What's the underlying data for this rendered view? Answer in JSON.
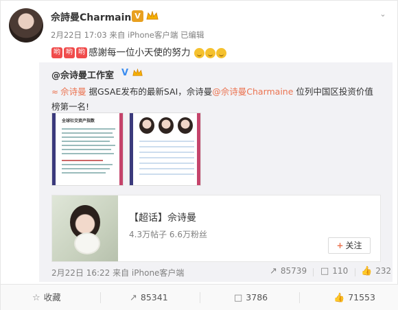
{
  "post": {
    "author": "佘詩曼Charmaine",
    "verified_badge": "V",
    "meta": "2月22日 17:03 来自 iPhone客户端   已编辑",
    "emoji_tags": [
      "哟",
      "哟",
      "哟"
    ],
    "text": "感謝每一位小天使的努力"
  },
  "repost": {
    "author": "@佘诗曼工作室",
    "verified_badge": "V",
    "link1": "佘诗曼",
    "text1": " 据GSAE发布的最新SAI，佘诗曼",
    "link2": "@佘诗曼Charmaine",
    "text2": " 位列中国区投资价值榜第一名!",
    "thumb1_title": "全球社交资产指数",
    "topic": {
      "title": "【超话】佘诗曼",
      "stats": "4.3万帖子 6.6万粉丝",
      "follow_label": "关注"
    },
    "footer": {
      "time": "2月22日 16:22 来自 iPhone客户端",
      "reposts": "85739",
      "comments": "110",
      "likes": "232"
    }
  },
  "actions": {
    "favorite": "收藏",
    "repost": "85341",
    "comment": "3786",
    "like": "71553"
  },
  "colors": {
    "link": "#eb7350",
    "verified_gold": "#e8a020",
    "verified_blue": "#3a8cf0"
  }
}
